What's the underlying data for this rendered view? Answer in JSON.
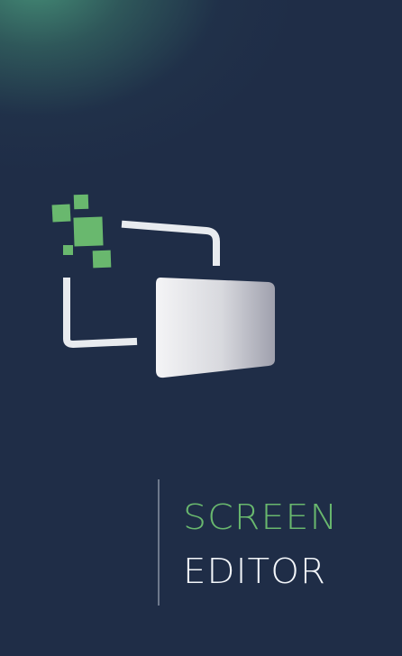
{
  "app": {
    "title_line_1": "SCREEN",
    "title_line_2": "EDITOR"
  },
  "icons": {
    "logo": "screen-editor-logo-icon"
  },
  "colors": {
    "background": "#1f2d47",
    "accent_green": "#69b86e",
    "text_white": "#f3f6fa",
    "frame": "#e8ebef",
    "screen_gray": "#c7c9d2"
  }
}
